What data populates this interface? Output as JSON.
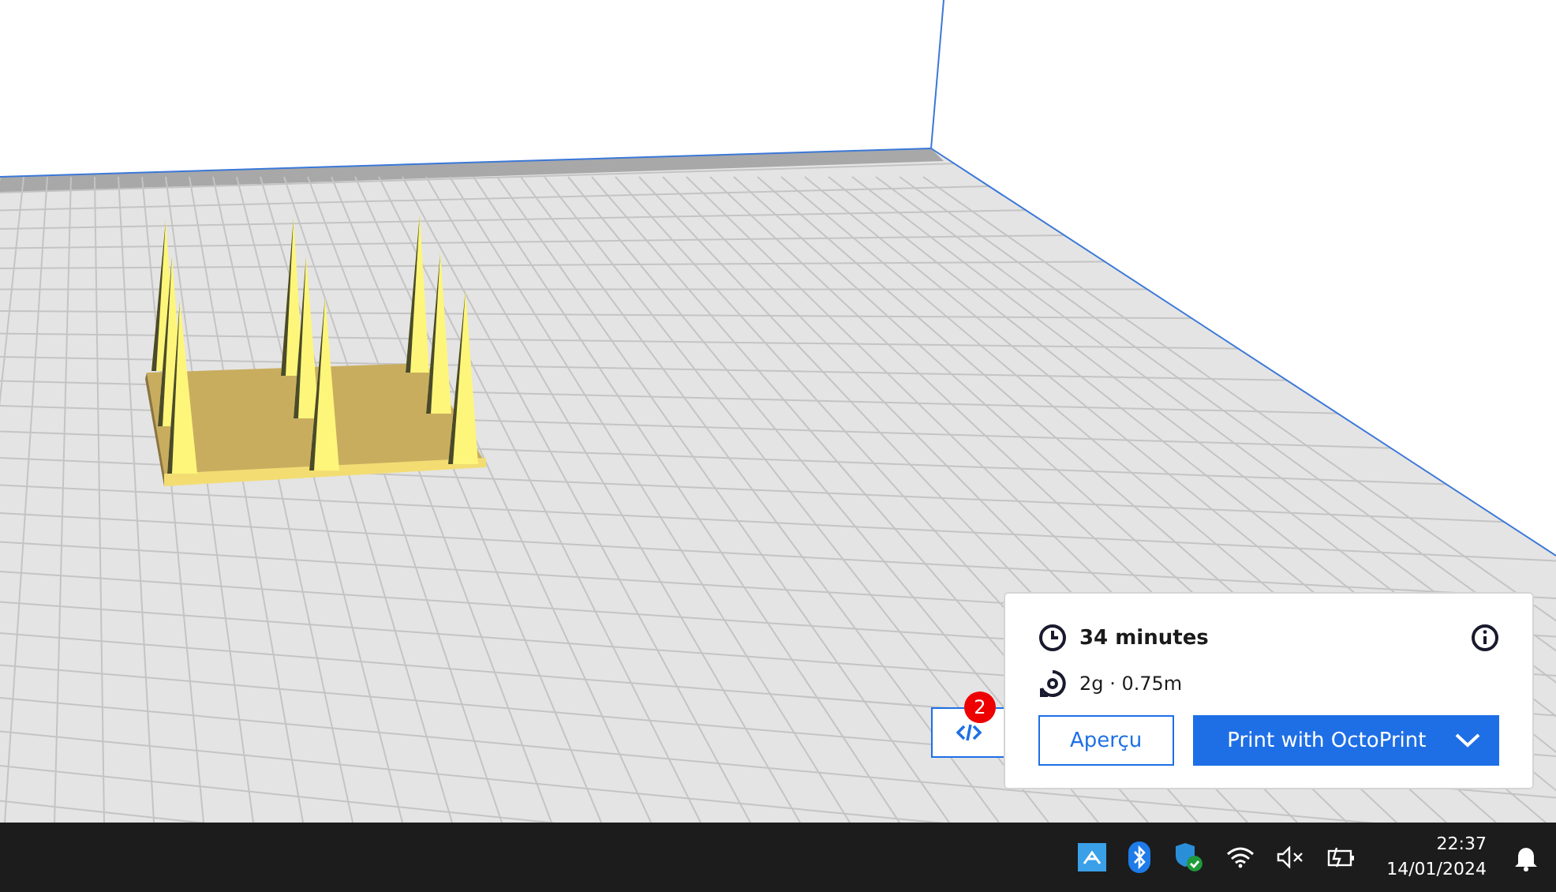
{
  "toolbar_button": {
    "badge": "2"
  },
  "print_panel": {
    "time": "34 minutes",
    "material": "2g · 0.75m",
    "preview_button": "Aperçu",
    "print_button": "Print with OctoPrint"
  },
  "taskbar": {
    "time": "22:37",
    "date": "14/01/2024"
  }
}
